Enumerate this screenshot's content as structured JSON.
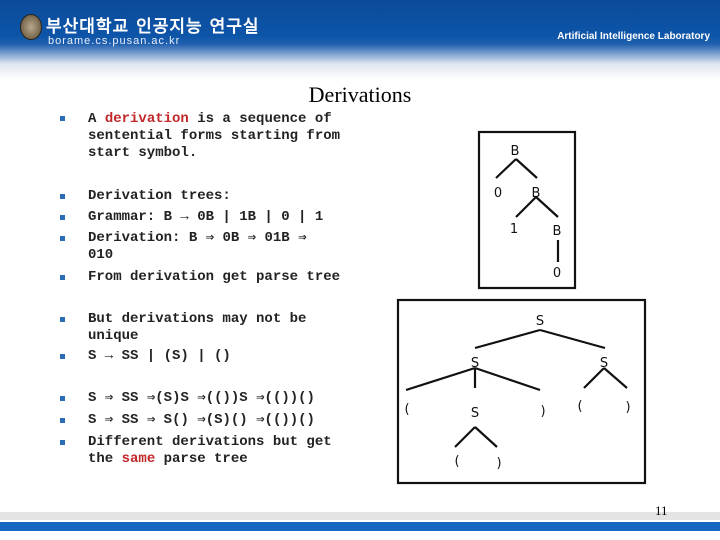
{
  "header": {
    "lab_name_korean": "부산대학교 인공지능 연구실",
    "url": "borame.cs.pusan.ac.kr",
    "lab_name": "Artificial Intelligence Laboratory"
  },
  "title": "Derivations",
  "lines": {
    "l1a": "A ",
    "l1b": "derivation",
    "l1c": " is a sequence of",
    "l2": "sentential forms starting from",
    "l3": "start symbol.",
    "l4": "Derivation trees:",
    "l5": "Grammar: B → 0B | 1B | 0 | 1",
    "l6": "Derivation: B ⇒ 0B ⇒ 01B ⇒",
    "l7": "010",
    "l8": "From derivation get parse tree",
    "l9": "But derivations may not be",
    "l10": "unique",
    "l11": "S → SS | (S) | ()",
    "l12": "S ⇒ SS ⇒(S)S ⇒(())S ⇒(())()",
    "l13": "S ⇒ SS ⇒ S() ⇒(S)() ⇒(())()",
    "l14": "Different derivations but get",
    "l15a": "the ",
    "l15b": "same",
    "l15c": " parse tree"
  },
  "tree1": {
    "n1": "B",
    "n2": "0",
    "n3": "B",
    "n4": "1",
    "n5": "B",
    "n6": "0"
  },
  "tree2": {
    "root": "S",
    "left": "S",
    "right": "S",
    "lp": "(",
    "mid": "S",
    "rp": ")",
    "rlp": "(",
    "rrp": ")",
    "blp": "(",
    "brp": ")"
  },
  "page_number": "11",
  "colors": {
    "accent": "#c0282a",
    "header": "#0d55a8",
    "bullet": "#2a6db5"
  }
}
